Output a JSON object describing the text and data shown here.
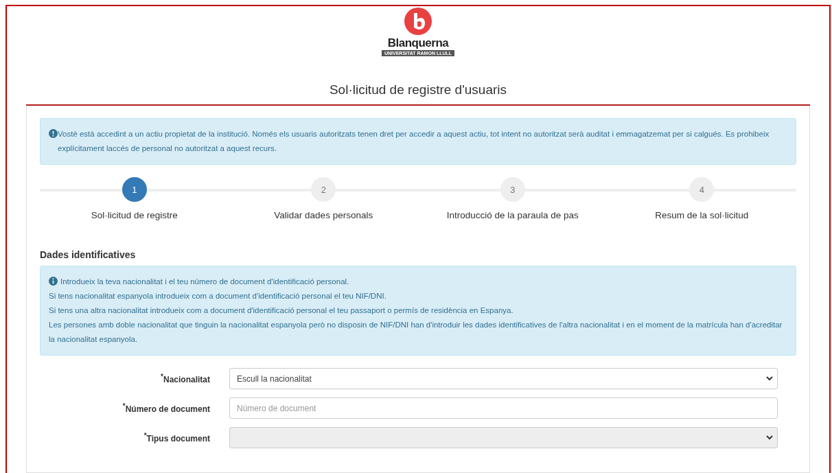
{
  "logo": {
    "name": "Blanquerna",
    "subtitle": "UNIVERSITAT RAMON LLULL"
  },
  "title": "Sol·licitud de registre d'usuaris",
  "notice": "Vostè està accedint a un actiu propietat de la institució. Només els usuaris autoritzats tenen dret per accedir a aquest actiu, tot intent no autoritzat serà auditat i emmagatzemat per si calgués. Es prohibeix explícitament laccés de personal no autoritzat a aquest recurs.",
  "steps": [
    {
      "number": "1",
      "label": "Sol·licitud de registre",
      "selected": true
    },
    {
      "number": "2",
      "label": "Validar dades personals",
      "selected": false
    },
    {
      "number": "3",
      "label": "Introducció de la paraula de pas",
      "selected": false
    },
    {
      "number": "4",
      "label": "Resum de la sol·licitud",
      "selected": false
    }
  ],
  "section_title": "Dades identificatives",
  "info_lines": [
    "Introdueix la teva nacionalitat i el teu número de document d'identificació personal.",
    "Si tens nacionalitat espanyola introdueix com a document d'identificació personal el teu NIF/DNI.",
    "Si tens una altra nacionalitat introdueix com a document d'identificació personal el teu passaport o permís de residència en Espanya.",
    "Les persones amb doble nacionalitat que tinguin la nacionalitat espanyola però no disposin de NIF/DNI han d'introduir les dades identificatives de l'altra nacionalitat i en el moment de la matrícula han d'acreditar la nacionalitat espanyola."
  ],
  "fields": [
    {
      "kind": "select",
      "label": "$^{*}$Nacionalitat",
      "value": "Escull la nacionalitat",
      "disabled": false
    },
    {
      "kind": "text",
      "label": "$^{*}$Número de document",
      "placeholder": "Número de document",
      "disabled": false
    },
    {
      "kind": "select",
      "label": "$^{*}$Tipus document",
      "disabled": true
    }
  ]
}
